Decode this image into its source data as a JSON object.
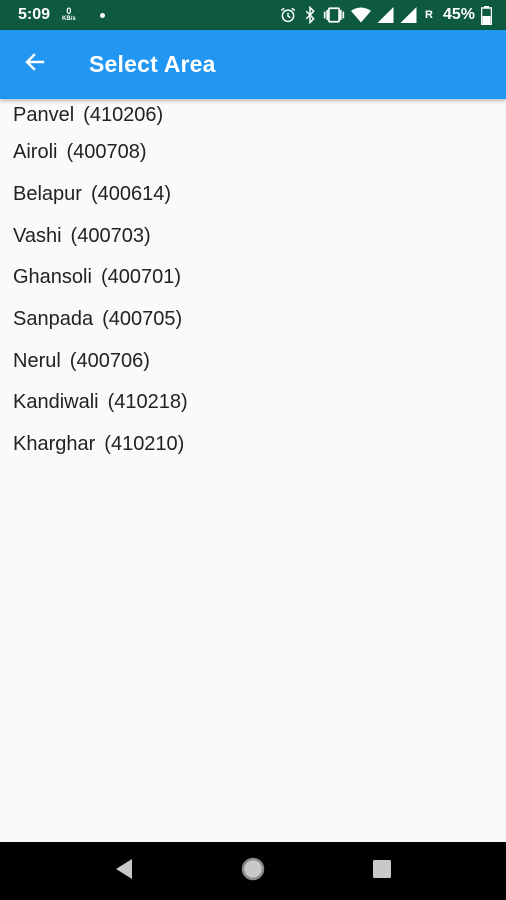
{
  "status_bar": {
    "time": "5:09",
    "net_speed_value": "0",
    "net_speed_unit": "KB/s",
    "roaming": "R",
    "battery": "45%",
    "icons": [
      "alarm-icon",
      "bluetooth-icon",
      "vibrate-icon",
      "wifi-icon",
      "signal-icon",
      "signal-icon",
      "battery-icon"
    ]
  },
  "app_bar": {
    "title": "Select Area",
    "back_icon": "arrow-left-icon",
    "background_color": "#2196f3"
  },
  "areas": [
    {
      "name": "Panvel",
      "code": "(410206)"
    },
    {
      "name": "Airoli",
      "code": "(400708)"
    },
    {
      "name": "Belapur",
      "code": "(400614)"
    },
    {
      "name": "Vashi",
      "code": "(400703)"
    },
    {
      "name": "Ghansoli",
      "code": "(400701)"
    },
    {
      "name": "Sanpada",
      "code": "(400705)"
    },
    {
      "name": "Nerul",
      "code": "(400706)"
    },
    {
      "name": "Kandiwali",
      "code": "(410218)"
    },
    {
      "name": "Kharghar",
      "code": "(410210)"
    }
  ],
  "nav_bar": {
    "icons": [
      "back-triangle-icon",
      "home-circle-icon",
      "recents-square-icon"
    ]
  }
}
